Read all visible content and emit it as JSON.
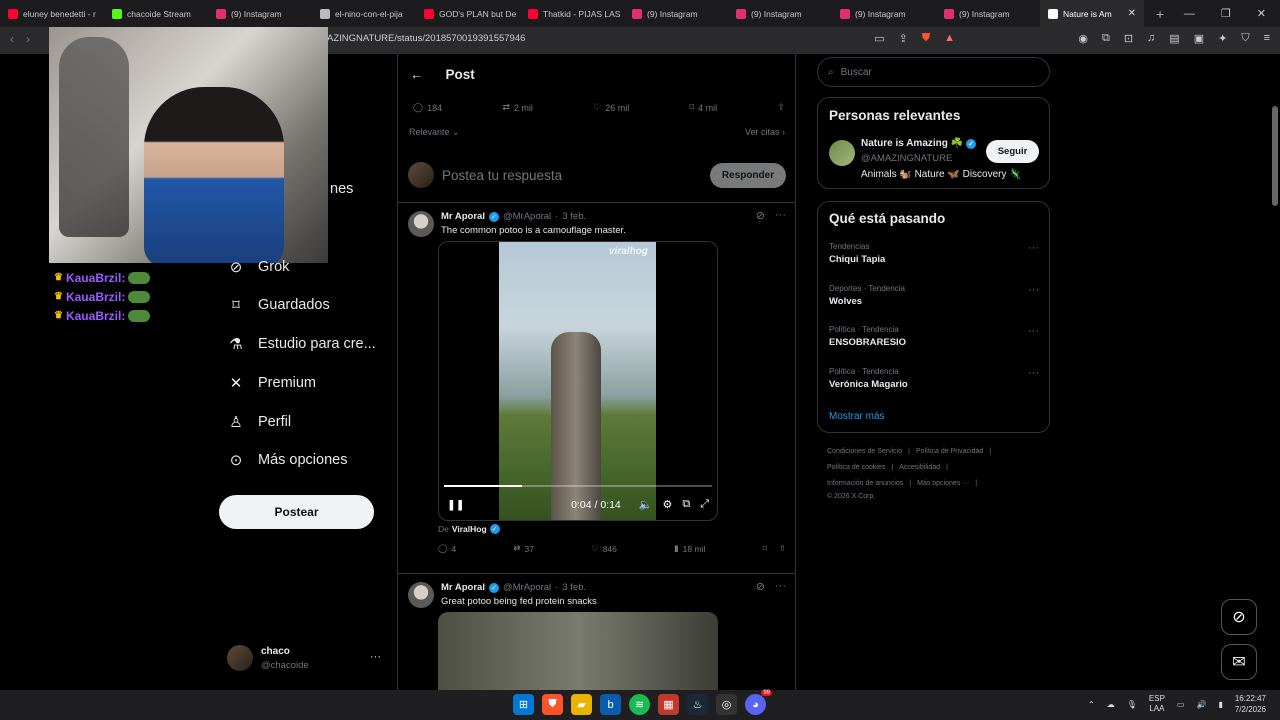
{
  "browser": {
    "tabs": [
      {
        "label": "eluney benedetti - r",
        "color": "#ff0033"
      },
      {
        "label": "chacoide Stream",
        "color": "#53fc18"
      },
      {
        "label": "(9) Instagram",
        "color": "#e1306c"
      },
      {
        "label": "el-nino-con-el-pija",
        "color": "#bbbbbb"
      },
      {
        "label": "GOD's PLAN but De",
        "color": "#ff0033"
      },
      {
        "label": "Thatkid - PIJAS LAS",
        "color": "#ff0033"
      },
      {
        "label": "(9) Instagram",
        "color": "#e1306c"
      },
      {
        "label": "(9) Instagram",
        "color": "#e1306c"
      },
      {
        "label": "(9) Instagram",
        "color": "#e1306c"
      },
      {
        "label": "(9) Instagram",
        "color": "#e1306c"
      },
      {
        "label": "Nature is Am",
        "color": "#ffffff"
      }
    ],
    "url": "AZINGNATURE/status/2018570019391557946"
  },
  "stream_chat": [
    {
      "user": "KauaBrzil:"
    },
    {
      "user": "KauaBrzil:"
    },
    {
      "user": "KauaBrzil:"
    }
  ],
  "sidebar": {
    "partial_item": "nes",
    "items": [
      {
        "label": "Grok",
        "icon": "grok-icon"
      },
      {
        "label": "Guardados",
        "icon": "bookmark-icon"
      },
      {
        "label": "Estudio para cre...",
        "icon": "flask-icon"
      },
      {
        "label": "Premium",
        "icon": "x-logo-icon"
      },
      {
        "label": "Perfil",
        "icon": "person-icon"
      },
      {
        "label": "Más opciones",
        "icon": "more-circle-icon"
      }
    ],
    "post_button": "Postear",
    "account": {
      "name": "chaco",
      "handle": "@chacoide"
    }
  },
  "post": {
    "header": "Post",
    "stats": {
      "replies": "184",
      "reposts": "2 mil",
      "likes": "26 mil",
      "bookmarks": "4 mil"
    },
    "sort_label": "Relevante",
    "quotes_link": "Ver citas",
    "reply_placeholder": "Postea tu respuesta",
    "reply_button": "Responder"
  },
  "replies": [
    {
      "name": "Mr Aporal",
      "handle": "@MrAporal",
      "date": "3 feb.",
      "text": "The common potoo is a camouflage master.",
      "video": {
        "watermark": "viralhog",
        "time": "0:04 / 0:14",
        "progress": 0.29
      },
      "from_label": "De",
      "from_user": "ViralHog",
      "actions": {
        "replies": "4",
        "reposts": "37",
        "likes": "846",
        "views": "18 mil"
      }
    },
    {
      "name": "Mr Aporal",
      "handle": "@MrAporal",
      "date": "3 feb.",
      "text": "Great potoo being fed protein snacks"
    }
  ],
  "right": {
    "search_placeholder": "Buscar",
    "relevant": {
      "title": "Personas relevantes",
      "name": "Nature is Amazing ☘️",
      "handle": "@AMAZINGNATURE",
      "bio": "Animals 🐿️ Nature 🦋 Discovery 🦎",
      "follow": "Seguir"
    },
    "trends": {
      "title": "Qué está pasando",
      "items": [
        {
          "category": "Tendencias",
          "name": "Chiqui Tapia"
        },
        {
          "category": "Deportes · Tendencia",
          "name": "Wolves"
        },
        {
          "category": "Política · Tendencia",
          "name": "ENSOBRARESIO"
        },
        {
          "category": "Política · Tendencia",
          "name": "Verónica Magario"
        }
      ],
      "more": "Mostrar más"
    },
    "footer": [
      [
        "Condiciones de Servicio",
        "Política de Privacidad"
      ],
      [
        "Política de cookies",
        "Accesibilidad"
      ],
      [
        "Información de anuncios",
        "Más opciones ···"
      ],
      [
        "© 2026 X Corp."
      ]
    ]
  },
  "taskbar": {
    "lang": "ESP",
    "lang2": "LAA",
    "time": "16:22:47",
    "date": "7/2/2026",
    "badge": "99"
  }
}
